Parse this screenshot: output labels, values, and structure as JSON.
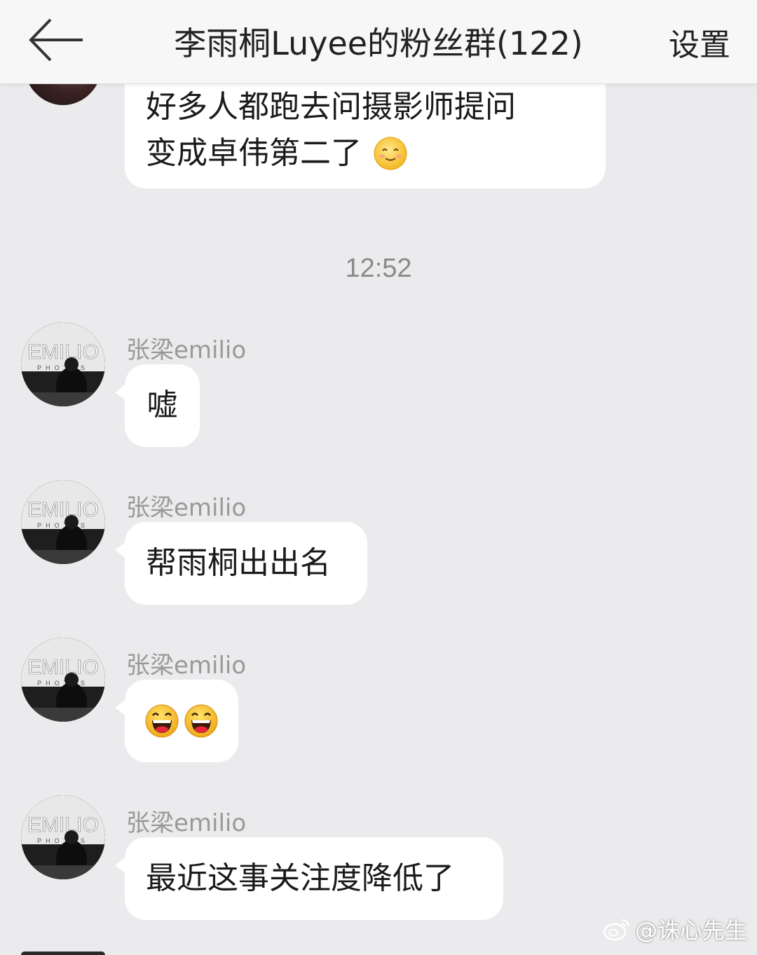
{
  "header": {
    "title": "李雨桐Luyee的粉丝群(122)",
    "settings_label": "设置"
  },
  "messages_top": {
    "line1": "好多人都跑去问摄影师提问",
    "line2": "变成卓伟第二了",
    "emoji": "smile-emoji"
  },
  "timestamp": "12:52",
  "messages": [
    {
      "sender": "张梁emilio",
      "text": "嘘"
    },
    {
      "sender": "张梁emilio",
      "text": "帮雨桐出出名"
    },
    {
      "sender": "张梁emilio",
      "text": "",
      "emoji": "laughing-emoji"
    },
    {
      "sender": "张梁emilio",
      "text": "最近这事关注度降低了"
    }
  ],
  "avatar": {
    "logo_text": "EMILIO",
    "logo_sub": "PHOTOS"
  },
  "watermark": {
    "text": "@诛心先生",
    "icon": "weibo-icon"
  }
}
